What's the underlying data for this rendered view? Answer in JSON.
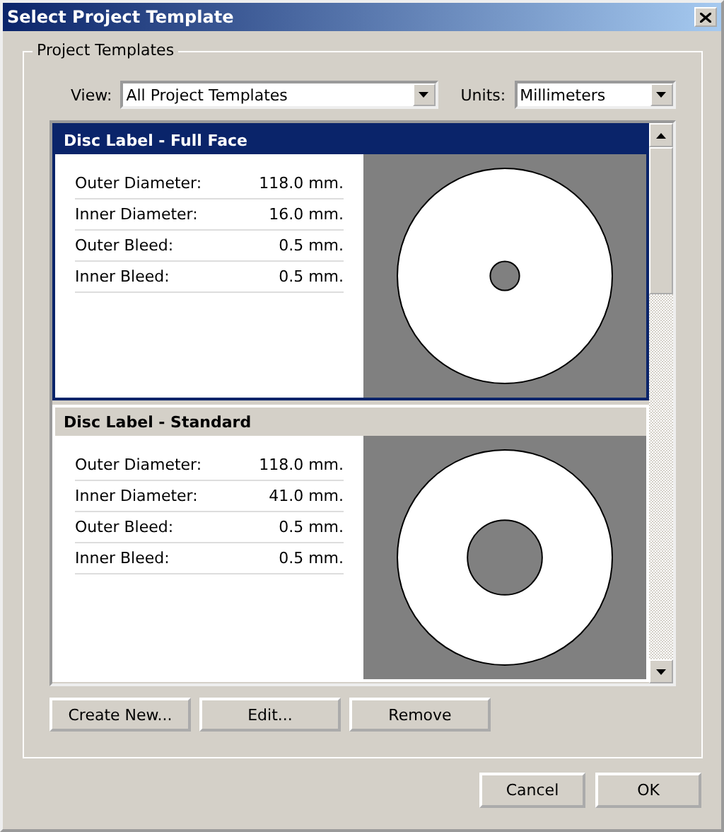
{
  "window": {
    "title": "Select Project Template"
  },
  "group": {
    "title": "Project Templates"
  },
  "view": {
    "label": "View:",
    "value": "All Project Templates"
  },
  "units": {
    "label": "Units:",
    "value": "Millimeters"
  },
  "templates": [
    {
      "name": "Disc Label - Full Face",
      "selected": true,
      "rows": [
        {
          "label": "Outer Diameter:",
          "value": "118.0 mm."
        },
        {
          "label": "Inner Diameter:",
          "value": "16.0 mm."
        },
        {
          "label": "Outer Bleed:",
          "value": "0.5 mm."
        },
        {
          "label": "Inner Bleed:",
          "value": "0.5 mm."
        }
      ]
    },
    {
      "name": "Disc Label - Standard",
      "selected": false,
      "rows": [
        {
          "label": "Outer Diameter:",
          "value": "118.0 mm."
        },
        {
          "label": "Inner Diameter:",
          "value": "41.0 mm."
        },
        {
          "label": "Outer Bleed:",
          "value": "0.5 mm."
        },
        {
          "label": "Inner Bleed:",
          "value": "0.5 mm."
        }
      ]
    }
  ],
  "list_buttons": [
    "Create New...",
    "Edit...",
    "Remove"
  ],
  "dialog_buttons": [
    "Cancel",
    "OK"
  ]
}
